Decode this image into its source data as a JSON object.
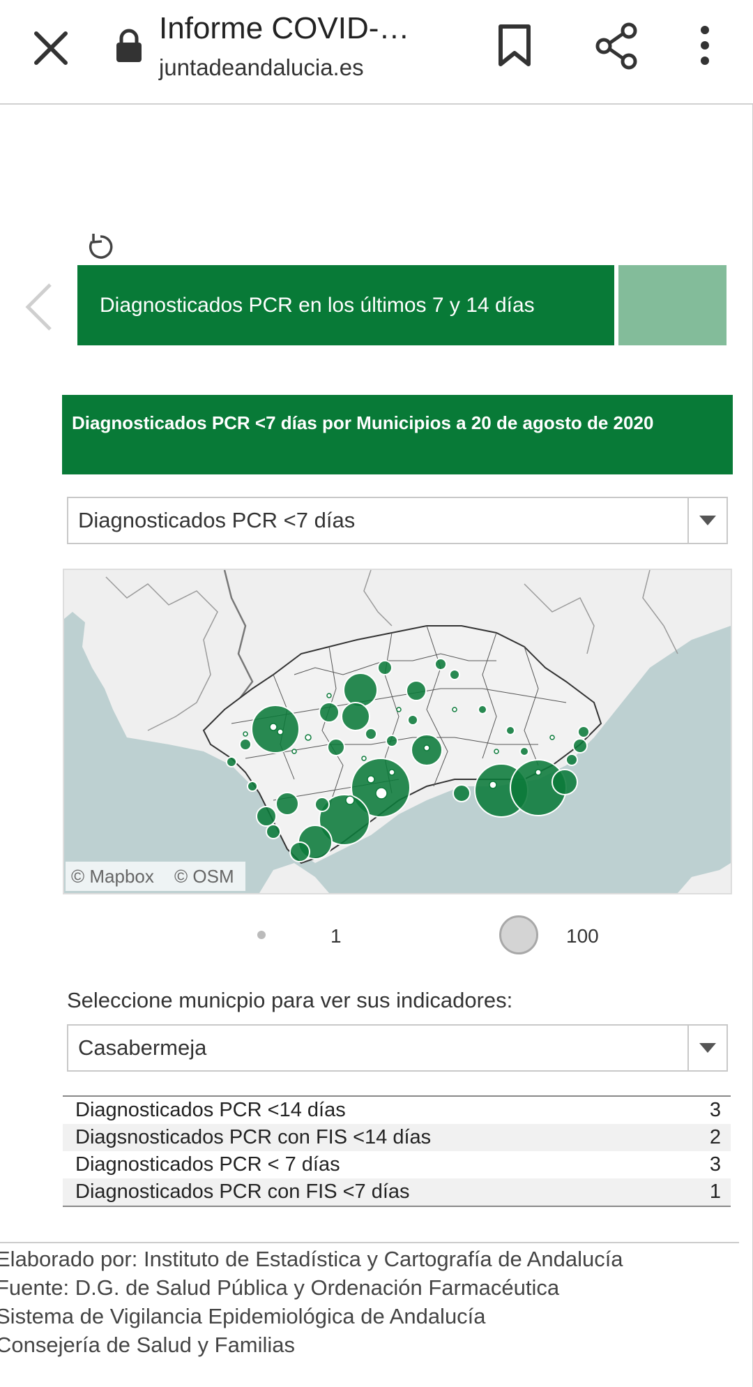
{
  "browser": {
    "title": "Informe COVID-…",
    "url": "juntadeandalucia.es"
  },
  "tabs": {
    "active_label": "Diagnosticados PCR en los últimos 7 y 14 días"
  },
  "panel": {
    "header": "Diagnosticados PCR <7 días por Municipios a 20 de agosto de 2020",
    "metric_select": "Diagnosticados PCR <7 días"
  },
  "map": {
    "attribution_mapbox": "© Mapbox",
    "attribution_osm": "© OSM",
    "bubble_color": "#0b7a3a"
  },
  "legend": {
    "min_label": "1",
    "max_label": "100"
  },
  "municipio": {
    "prompt": "Seleccione municpio para ver sus indicadores:",
    "selected": "Casabermeja"
  },
  "indicators": [
    {
      "label": "Diagnosticados PCR <14 días",
      "value": "3"
    },
    {
      "label": "Diagsnosticados PCR con FIS <14 días",
      "value": "2"
    },
    {
      "label": "Diagnosticados PCR < 7 días",
      "value": "3"
    },
    {
      "label": "Diagnosticados PCR con FIS <7 días",
      "value": "1"
    }
  ],
  "footer": {
    "line1": "Elaborado por: Instituto de Estadística y Cartografía de Andalucía",
    "line2": "Fuente: D.G. de Salud Pública y Ordenación Farmacéutica",
    "line3": "Sistema de Vigilancia Epidemiológica de Andalucía",
    "line4": "Consejería de Salud y Familias"
  }
}
